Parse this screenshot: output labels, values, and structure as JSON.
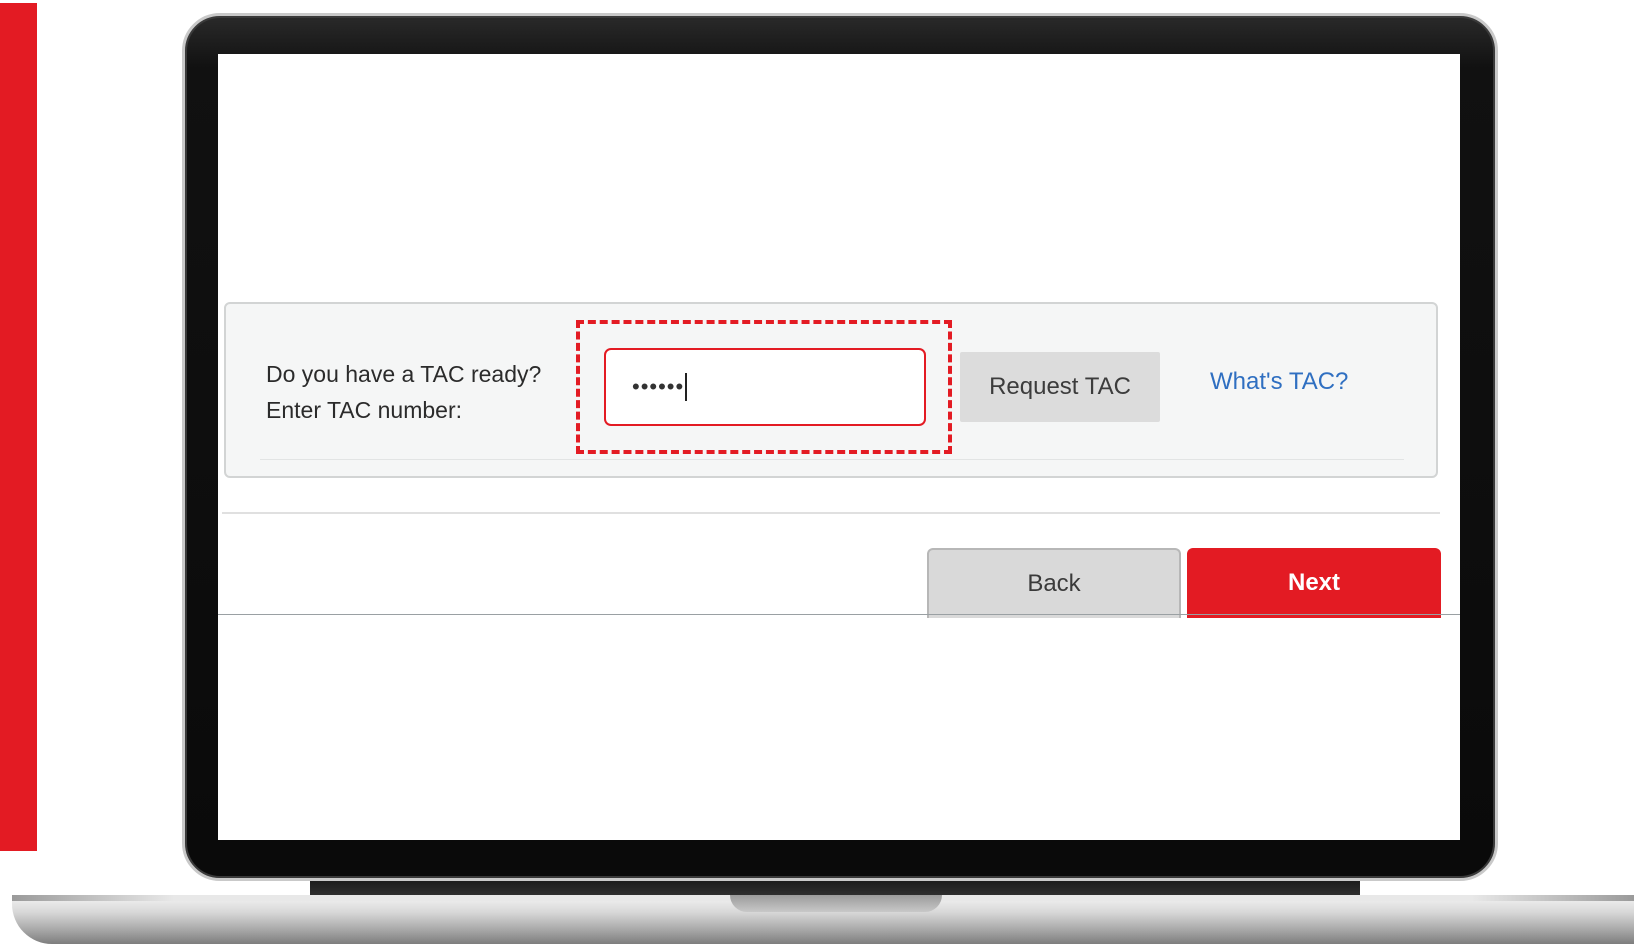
{
  "tac_form": {
    "question_line1": "Do you have a TAC ready?",
    "question_line2": "Enter TAC number:",
    "input_value": "••••••",
    "request_button_label": "Request TAC",
    "help_link_label": "What's TAC?"
  },
  "navigation": {
    "back_label": "Back",
    "next_label": "Next"
  },
  "colors": {
    "accent": "#e31b23",
    "link": "#2f6fc1",
    "secondary_button": "#dcdcdc"
  }
}
